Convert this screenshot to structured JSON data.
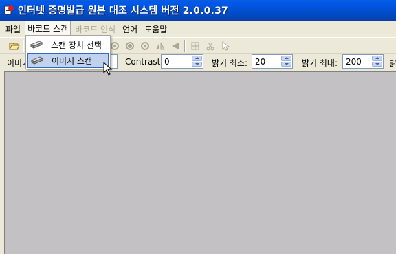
{
  "window": {
    "title": "인터넷 증명발급 원본 대조 시스템 버전 2.0.0.37"
  },
  "menubar": {
    "items": [
      {
        "label": "파일",
        "state": "normal"
      },
      {
        "label": "바코드 스캔",
        "state": "open"
      },
      {
        "label": "바코드 인식",
        "state": "disabled"
      },
      {
        "label": "언어",
        "state": "normal"
      },
      {
        "label": "도움말",
        "state": "normal"
      }
    ]
  },
  "scan_menu": {
    "items": [
      {
        "label": "스캔 장치 선택",
        "icon": "scanner-icon"
      },
      {
        "label": "이미지 스캔",
        "icon": "scanner-icon",
        "highlighted": true
      }
    ]
  },
  "toolbar": {
    "icons": [
      "open-folder-icon",
      "rotate-left-icon",
      "rotate-right-icon",
      "flip-horizontal-icon",
      "flip-vertical-icon",
      "crop-icon",
      "cut-icon",
      "pointer-icon"
    ]
  },
  "options": {
    "image_label_partial": "이미기",
    "contrast_label": "Contrast:",
    "contrast_value": "0",
    "brightness_min_label": "밝기 최소:",
    "brightness_min_value": "20",
    "brightness_max_label": "밝기 최대:",
    "brightness_max_value": "200",
    "trailing_partial": "밝"
  },
  "colors": {
    "titlebar": "#0053d6",
    "chrome": "#ece9d8",
    "canvas": "#c3c1c3",
    "menu_highlight": "#c1d2ee"
  }
}
